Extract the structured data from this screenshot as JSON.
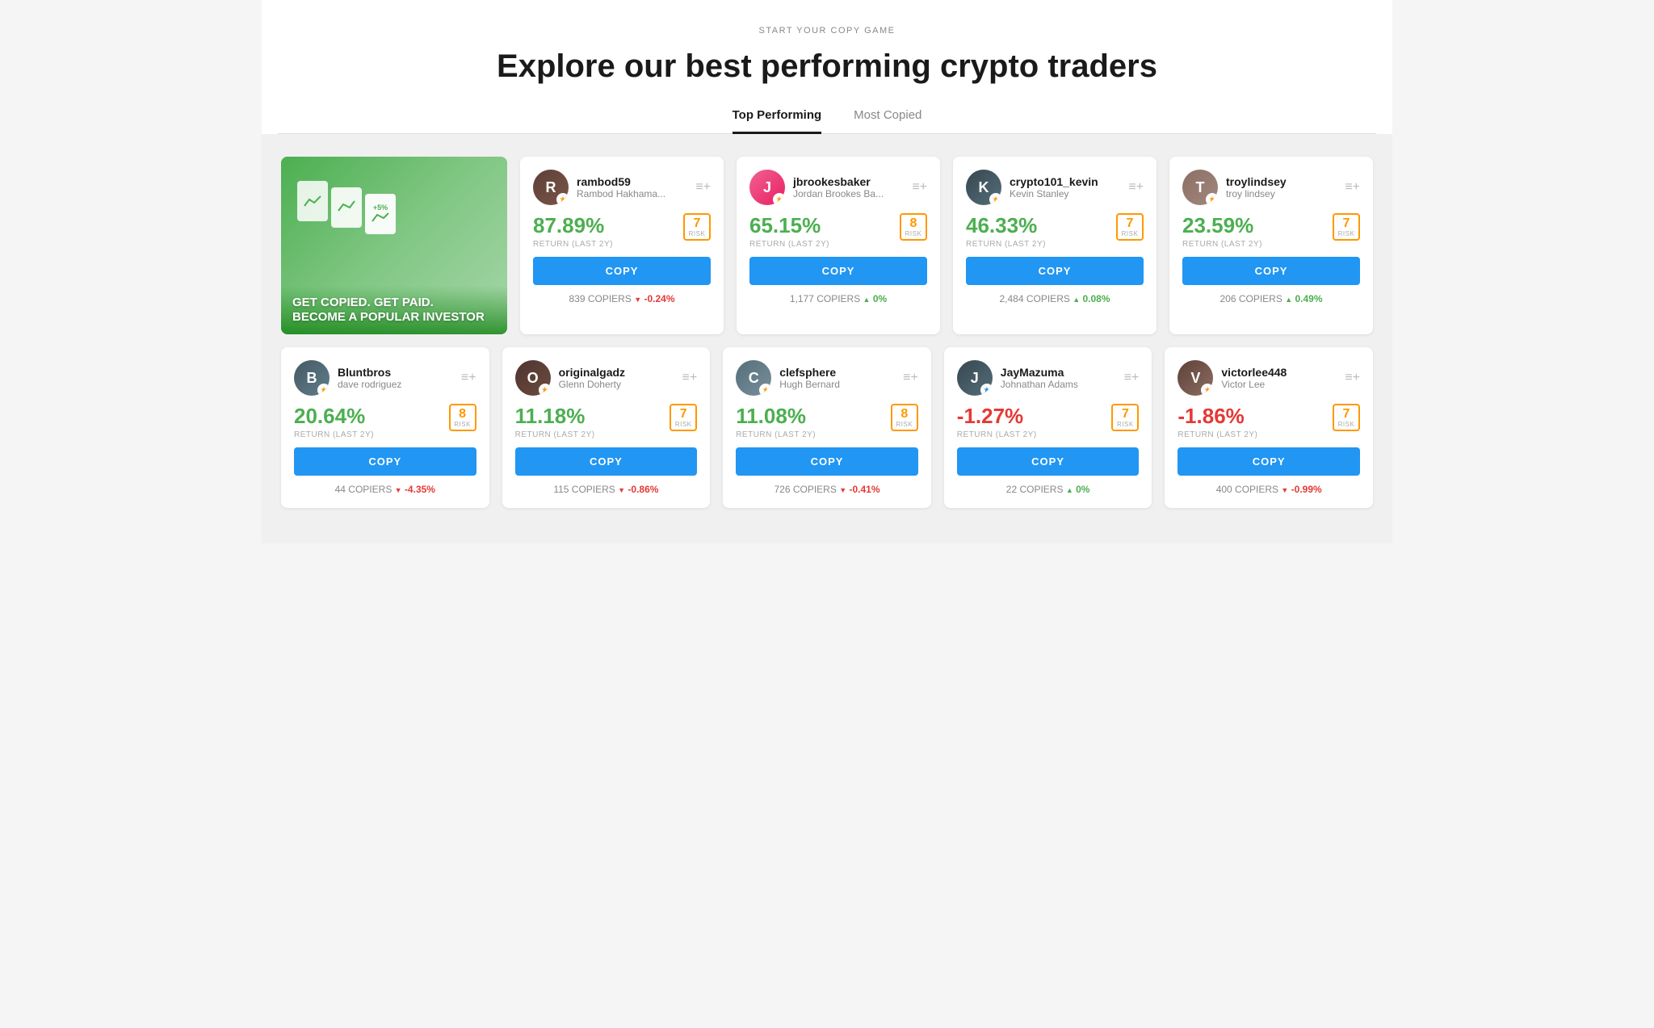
{
  "header": {
    "start_label": "START YOUR COPY GAME",
    "main_title": "Explore our best performing crypto traders",
    "tabs": [
      {
        "id": "top-performing",
        "label": "Top Performing",
        "active": true
      },
      {
        "id": "most-copied",
        "label": "Most Copied",
        "active": false
      }
    ]
  },
  "promo": {
    "headline_line1": "GET COPIED. GET PAID.",
    "headline_line2": "BECOME A POPULAR INVESTOR"
  },
  "traders_row1": [
    {
      "username": "rambod59",
      "fullname": "Rambod Hakhama...",
      "return": "87.89%",
      "return_label": "RETURN (LAST 2Y)",
      "risk": "7",
      "risk_label": "RISK",
      "copiers": "839 COPIERS",
      "trend_direction": "down",
      "trend_value": "-0.24%",
      "star_color": "orange",
      "avatar_class": "avatar-rambod",
      "avatar_letter": "R"
    },
    {
      "username": "jbrookesbaker",
      "fullname": "Jordan Brookes Ba...",
      "return": "65.15%",
      "return_label": "RETURN (LAST 2Y)",
      "risk": "8",
      "risk_label": "RISK",
      "copiers": "1,177 COPIERS",
      "trend_direction": "up",
      "trend_value": "0%",
      "star_color": "orange",
      "avatar_class": "avatar-jbrooks",
      "avatar_letter": "J"
    },
    {
      "username": "crypto101_kevin",
      "fullname": "Kevin Stanley",
      "return": "46.33%",
      "return_label": "RETURN (LAST 2Y)",
      "risk": "7",
      "risk_label": "RISK",
      "copiers": "2,484 COPIERS",
      "trend_direction": "up",
      "trend_value": "0.08%",
      "star_color": "orange",
      "avatar_class": "avatar-crypto101",
      "avatar_letter": "K"
    },
    {
      "username": "troylindsey",
      "fullname": "troy lindsey",
      "return": "23.59%",
      "return_label": "RETURN (LAST 2Y)",
      "risk": "7",
      "risk_label": "RISK",
      "copiers": "206 COPIERS",
      "trend_direction": "up",
      "trend_value": "0.49%",
      "star_color": "orange",
      "avatar_class": "avatar-troy",
      "avatar_letter": "T"
    }
  ],
  "traders_row2": [
    {
      "username": "Bluntbros",
      "fullname": "dave rodriguez",
      "return": "20.64%",
      "return_label": "RETURN (LAST 2Y)",
      "risk": "8",
      "risk_label": "RISK",
      "copiers": "44 COPIERS",
      "trend_direction": "down",
      "trend_value": "-4.35%",
      "star_color": "orange",
      "avatar_class": "avatar-blunt",
      "avatar_letter": "B"
    },
    {
      "username": "originalgadz",
      "fullname": "Glenn Doherty",
      "return": "11.18%",
      "return_label": "RETURN (LAST 2Y)",
      "risk": "7",
      "risk_label": "RISK",
      "copiers": "115 COPIERS",
      "trend_direction": "down",
      "trend_value": "-0.86%",
      "star_color": "orange",
      "avatar_class": "avatar-original",
      "avatar_letter": "O"
    },
    {
      "username": "clefsphere",
      "fullname": "Hugh Bernard",
      "return": "11.08%",
      "return_label": "RETURN (LAST 2Y)",
      "risk": "8",
      "risk_label": "RISK",
      "copiers": "726 COPIERS",
      "trend_direction": "down",
      "trend_value": "-0.41%",
      "star_color": "orange",
      "avatar_class": "avatar-clef",
      "avatar_letter": "C"
    },
    {
      "username": "JayMazuma",
      "fullname": "Johnathan Adams",
      "return": "-1.27%",
      "return_label": "RETURN (LAST 2Y)",
      "return_negative": true,
      "risk": "7",
      "risk_label": "RISK",
      "copiers": "22 COPIERS",
      "trend_direction": "up",
      "trend_value": "0%",
      "star_color": "blue",
      "avatar_class": "avatar-jay",
      "avatar_letter": "J"
    },
    {
      "username": "victorlee448",
      "fullname": "Victor Lee",
      "return": "-1.86%",
      "return_label": "RETURN (LAST 2Y)",
      "return_negative": true,
      "risk": "7",
      "risk_label": "RISK",
      "copiers": "400 COPIERS",
      "trend_direction": "down",
      "trend_value": "-0.99%",
      "star_color": "orange",
      "avatar_class": "avatar-victor",
      "avatar_letter": "V"
    }
  ],
  "copy_button_label": "COPY"
}
